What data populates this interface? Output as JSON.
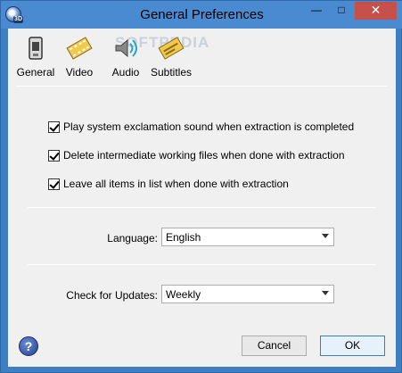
{
  "window": {
    "title": "General Preferences",
    "app_icon_text": "3D",
    "minimize_label": "—",
    "maximize_label": "□",
    "close_label": "✕"
  },
  "tabs": [
    {
      "label": "General",
      "icon": "phone-icon"
    },
    {
      "label": "Video",
      "icon": "film-icon"
    },
    {
      "label": "Audio",
      "icon": "speaker-icon"
    },
    {
      "label": "Subtitles",
      "icon": "subtitles-icon"
    }
  ],
  "watermark": "SOFTPEDIA",
  "options": [
    {
      "label": "Play system exclamation sound when extraction is completed",
      "checked": true
    },
    {
      "label": "Delete intermediate working files when done with extraction",
      "checked": true
    },
    {
      "label": "Leave all items in list when done with extraction",
      "checked": true
    }
  ],
  "language": {
    "label": "Language:",
    "value": "English"
  },
  "updates": {
    "label": "Check for Updates:",
    "value": "Weekly"
  },
  "buttons": {
    "help": "?",
    "cancel": "Cancel",
    "ok": "OK"
  }
}
